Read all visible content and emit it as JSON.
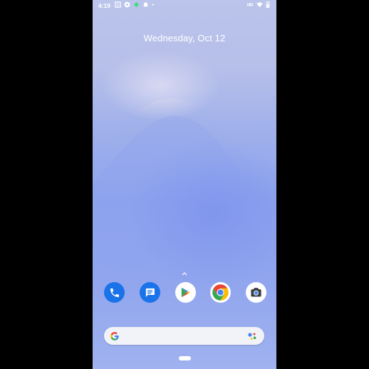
{
  "status_bar": {
    "time": "4:19",
    "left_icons": [
      "news-icon",
      "media-icon",
      "android-dot-icon",
      "android-icon",
      "more-dot-icon"
    ],
    "right_icons": [
      "link-icon",
      "wifi-icon",
      "battery-icon"
    ]
  },
  "home": {
    "date": "Wednesday, Oct 12"
  },
  "dock": {
    "apps": [
      {
        "name": "Phone",
        "icon": "phone-icon",
        "color": "#1a73e8"
      },
      {
        "name": "Messages",
        "icon": "messages-icon",
        "color": "#1a73e8"
      },
      {
        "name": "Play Store",
        "icon": "play-store-icon",
        "color": "#ffffff"
      },
      {
        "name": "Chrome",
        "icon": "chrome-icon",
        "color": "#ffffff"
      },
      {
        "name": "Camera",
        "icon": "camera-icon",
        "color": "#ffffff"
      }
    ]
  },
  "search_bar": {
    "logo": "google-g-icon",
    "mic": "assistant-icon"
  },
  "colors": {
    "accent_blue": "#1a73e8",
    "google_red": "#ea4335",
    "google_yellow": "#fbbc04",
    "google_green": "#34a853",
    "google_blue": "#4285f4"
  }
}
